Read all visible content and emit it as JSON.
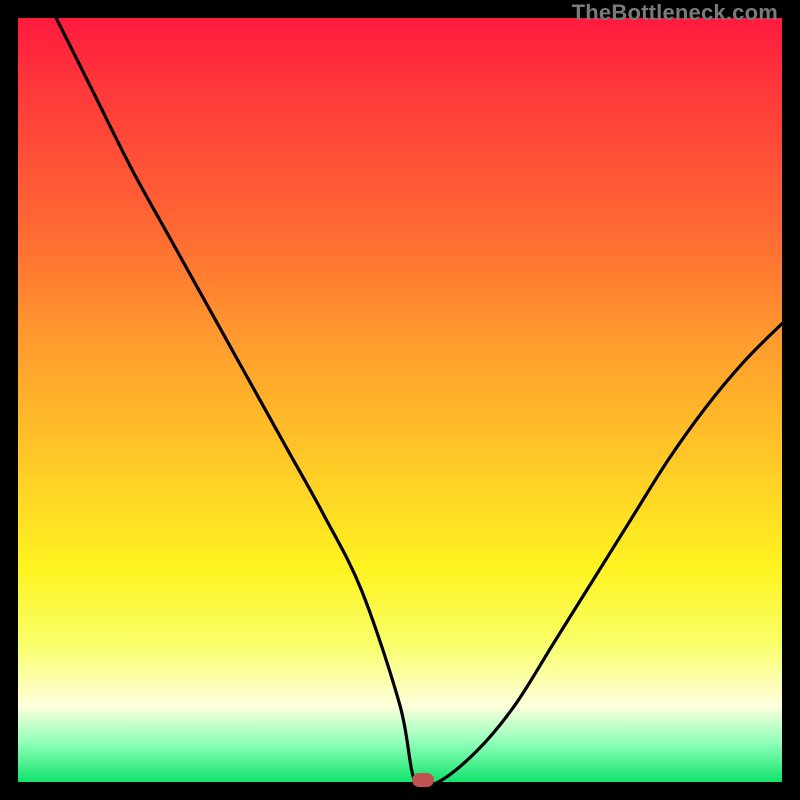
{
  "watermark": "TheBottleneck.com",
  "colors": {
    "frame": "#000000",
    "gradient_stops": [
      "#ff1a3e",
      "#ff3a3a",
      "#ff6a33",
      "#ff9a2e",
      "#ffc927",
      "#fff320",
      "#f8ff6a",
      "#ffffdc",
      "#8cffb8",
      "#11e36b"
    ],
    "curve": "#000000",
    "marker": "#c0524f"
  },
  "chart_data": {
    "type": "line",
    "title": "",
    "xlabel": "",
    "ylabel": "",
    "xlim": [
      0,
      100
    ],
    "ylim": [
      0,
      100
    ],
    "series": [
      {
        "name": "bottleneck-curve",
        "x": [
          5,
          10,
          15,
          20,
          25,
          30,
          35,
          40,
          45,
          50,
          52,
          55,
          60,
          65,
          70,
          75,
          80,
          85,
          90,
          95,
          100
        ],
        "y": [
          100,
          90,
          80,
          71,
          62,
          53,
          44,
          35,
          25,
          10,
          0,
          0,
          4,
          10,
          18,
          26,
          34,
          42,
          49,
          55,
          60
        ]
      }
    ],
    "annotations": [
      {
        "name": "minimum-marker",
        "x": 53,
        "y": 0
      }
    ],
    "grid": false,
    "legend": false
  }
}
